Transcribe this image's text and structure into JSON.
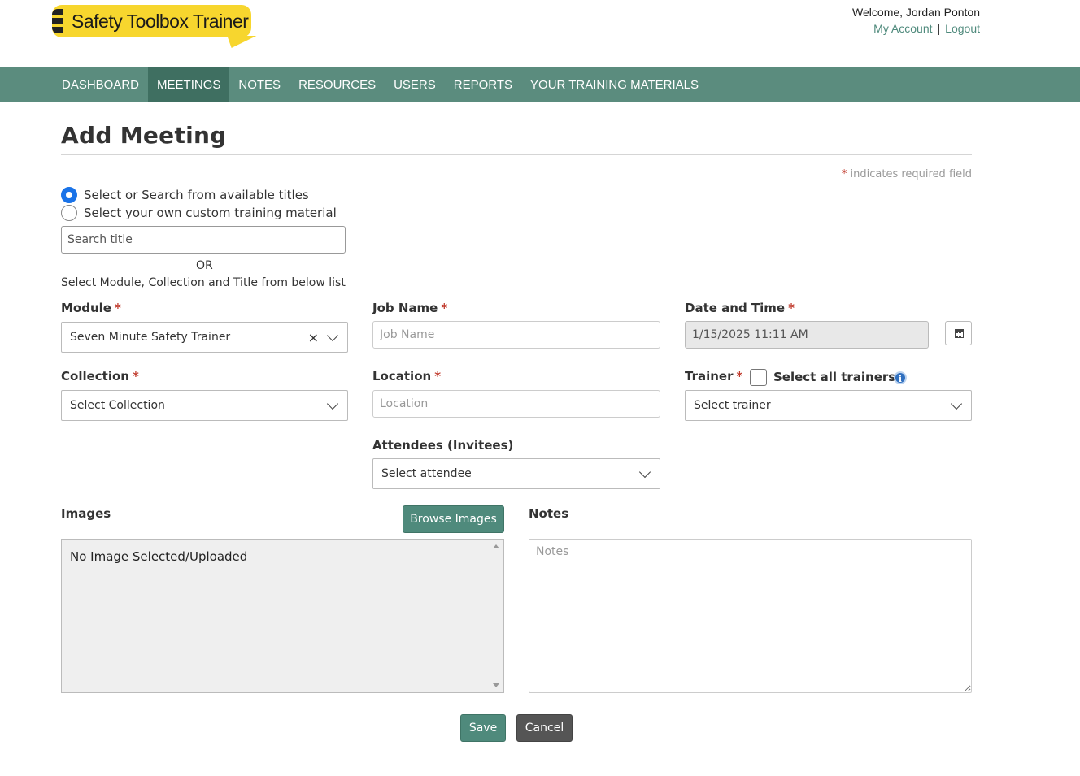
{
  "brand": {
    "logo_text": "Safety Toolbox Trainer",
    "accent": "#5b8c7e",
    "logo_color": "#f7d62e"
  },
  "account": {
    "welcome": "Welcome, Jordan Ponton",
    "my_account": "My Account",
    "separator": "|",
    "logout": "Logout"
  },
  "nav": {
    "items": [
      {
        "label": "DASHBOARD"
      },
      {
        "label": "MEETINGS",
        "active": true
      },
      {
        "label": "NOTES"
      },
      {
        "label": "RESOURCES"
      },
      {
        "label": "USERS"
      },
      {
        "label": "REPORTS"
      },
      {
        "label": "YOUR TRAINING MATERIALS"
      }
    ]
  },
  "page": {
    "title": "Add Meeting",
    "required_star": "*",
    "required_note": "indicates required field"
  },
  "source": {
    "option_search": "Select or Search from available titles",
    "option_custom": "Select your own custom training material",
    "selected": "search",
    "search_placeholder": "Search title",
    "or_text": "OR",
    "hint": "Select Module, Collection and Title from below list"
  },
  "fields": {
    "module": {
      "label": "Module",
      "value": "Seven Minute Safety Trainer",
      "clear": "×"
    },
    "collection": {
      "label": "Collection",
      "value": "Select Collection"
    },
    "job_name": {
      "label": "Job Name",
      "placeholder": "Job Name"
    },
    "location": {
      "label": "Location",
      "placeholder": "Location"
    },
    "attendees": {
      "label": "Attendees (Invitees)",
      "value": "Select attendee"
    },
    "date_time": {
      "label": "Date and Time",
      "value": "1/15/2025 11:11 AM"
    },
    "trainer": {
      "label": "Trainer",
      "select_all_label": "Select all trainers",
      "select_all_checked": false,
      "value": "Select trainer",
      "info": "i"
    }
  },
  "images": {
    "label": "Images",
    "browse_label": "Browse Images",
    "empty_text": "No Image Selected/Uploaded"
  },
  "notes": {
    "label": "Notes",
    "placeholder": "Notes"
  },
  "actions": {
    "save": "Save",
    "cancel": "Cancel"
  }
}
